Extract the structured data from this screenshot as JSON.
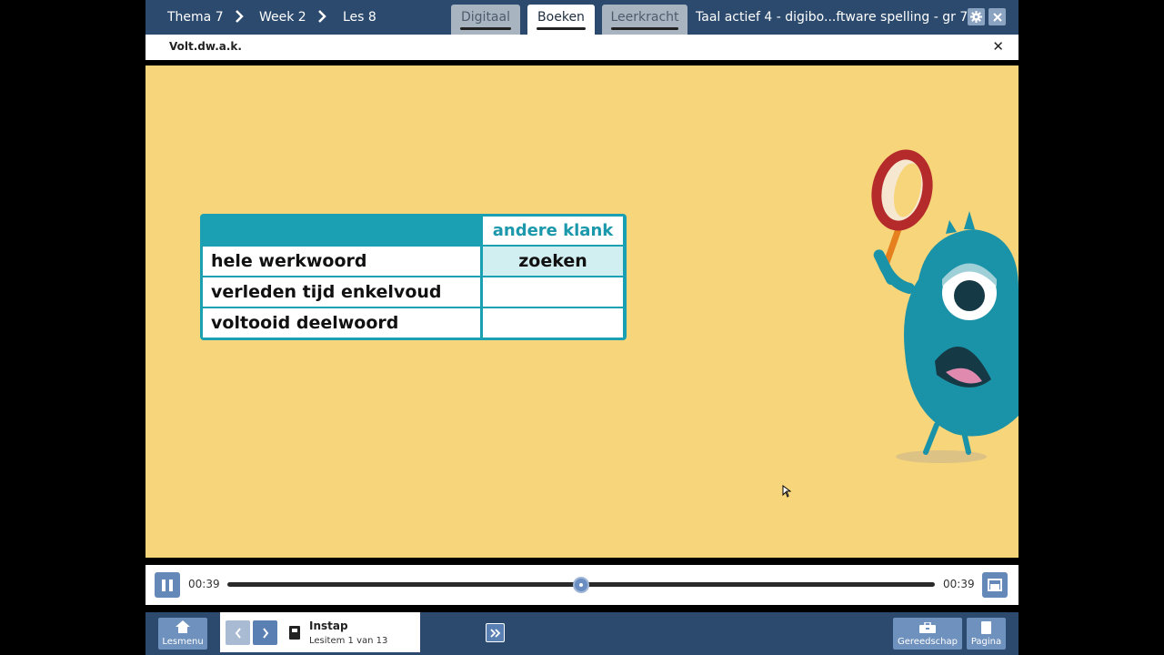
{
  "breadcrumb": {
    "theme": "Thema 7",
    "week": "Week 2",
    "lesson": "Les 8"
  },
  "tabs": [
    {
      "label": "Digitaal",
      "active": false
    },
    {
      "label": "Boeken",
      "active": true
    },
    {
      "label": "Leerkracht",
      "active": false
    }
  ],
  "book_title": "Taal actief 4 - digibo...ftware spelling - gr 7",
  "subheader": {
    "title": "Volt.dw.a.k."
  },
  "table": {
    "header": "andere klank",
    "rows": [
      {
        "label": "hele werkwoord",
        "value": "zoeken"
      },
      {
        "label": "verleden tijd enkelvoud",
        "value": ""
      },
      {
        "label": "voltooid deelwoord",
        "value": ""
      }
    ]
  },
  "player": {
    "current_time": "00:39",
    "total_time": "00:39",
    "progress": 0.5
  },
  "bottom": {
    "menu_label": "Lesmenu",
    "lesson_title": "Instap",
    "lesson_item": "Lesitem 1 van 13",
    "tools_label": "Gereedschap",
    "page_label": "Pagina"
  },
  "colors": {
    "topbar": "#2b4a6e",
    "stage": "#f7d57a",
    "teal": "#1aa0b2",
    "button": "#6f91bd"
  }
}
